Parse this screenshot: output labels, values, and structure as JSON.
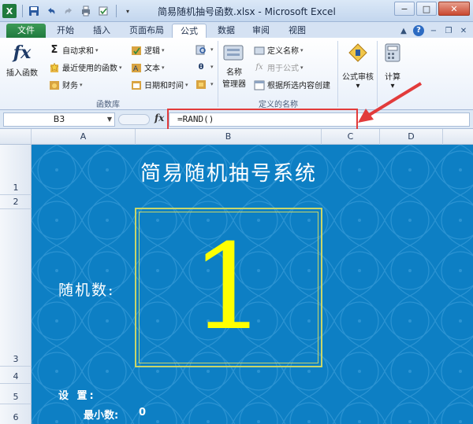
{
  "window": {
    "title": "简易随机抽号函数.xlsx - Microsoft Excel",
    "app_letter": "X",
    "minimize": "−",
    "maximize": "□",
    "close": "✕"
  },
  "tabs": {
    "file": "文件",
    "items": [
      "开始",
      "插入",
      "页面布局",
      "公式",
      "数据",
      "审阅",
      "视图"
    ],
    "active": "公式"
  },
  "ribbon": {
    "insert_function": "插入函数",
    "autosum": "自动求和",
    "recent": "最近使用的函数",
    "financial": "财务",
    "logical": "逻辑",
    "text": "文本",
    "datetime": "日期和时间",
    "group_library": "函数库",
    "name_manager_line1": "名称",
    "name_manager_line2": "管理器",
    "define_name": "定义名称",
    "use_in_formula": "用于公式",
    "create_from_selection": "根据所选内容创建",
    "group_names": "定义的名称",
    "formula_auditing": "公式审核",
    "calculation": "计算"
  },
  "formula_bar": {
    "name_box": "B3",
    "fx": "fx",
    "formula": "=RAND()"
  },
  "columns": [
    "A",
    "B",
    "C",
    "D"
  ],
  "rows": [
    "1",
    "2",
    "3",
    "4",
    "5",
    "6"
  ],
  "sheet": {
    "title": "简易随机抽号系统",
    "rand_label": "随机数:",
    "rand_value": "1",
    "settings_label": "设 置:",
    "min_label": "最小数:",
    "min_value": "0"
  },
  "colors": {
    "sheet_bg": "#0d7fc4",
    "highlight": "#e23b3b",
    "number": "#ffff00",
    "excel_green": "#1f7a3e"
  }
}
